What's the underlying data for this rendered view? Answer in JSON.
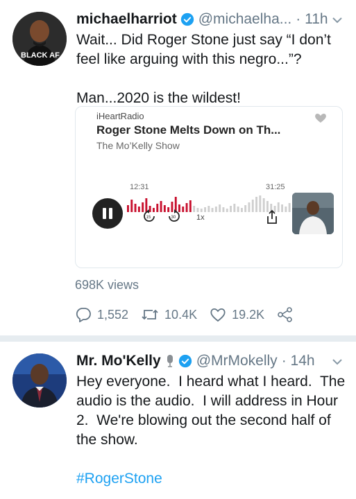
{
  "tweets": [
    {
      "name": "michaelharriot",
      "handle": "@michaelha...",
      "time": "· 11h",
      "avatar_badge": "BLACK AF",
      "text": "Wait... Did Roger Stone just say “I don’t feel like arguing with this negro...”?\n\nMan...2020 is the wildest!",
      "card": {
        "source": "iHeartRadio",
        "title": "Roger Stone Melts Down on Th...",
        "subtitle": "The Mo’Kelly Show",
        "time_elapsed": "12:31",
        "time_total": "31:25",
        "speed": "1x",
        "progress": 0.4
      },
      "views": "698K views",
      "stats": {
        "replies": "1,552",
        "retweets": "10.4K",
        "likes": "19.2K"
      }
    },
    {
      "name": "Mr. Mo'Kelly",
      "handle": "@MrMokelly",
      "time": "· 14h",
      "text": "Hey everyone.  I heard what I heard.  The audio is the audio.  I will address in Hour 2.  We're blowing out the second half of the show.",
      "hashtag": "#RogerStone"
    }
  ],
  "colors": {
    "accent": "#1da1f2",
    "muted": "#657786",
    "waveform_played": "#c8102e",
    "waveform_unplayed": "#cfcfcf",
    "divider": "#e6ecf0"
  },
  "icons": [
    "verified-icon",
    "chevron-down-icon",
    "reply-icon",
    "retweet-icon",
    "like-icon",
    "share-icon",
    "microphone-icon",
    "play-pause-icon",
    "rewind-15-icon",
    "forward-30-icon",
    "iheart-icon"
  ]
}
